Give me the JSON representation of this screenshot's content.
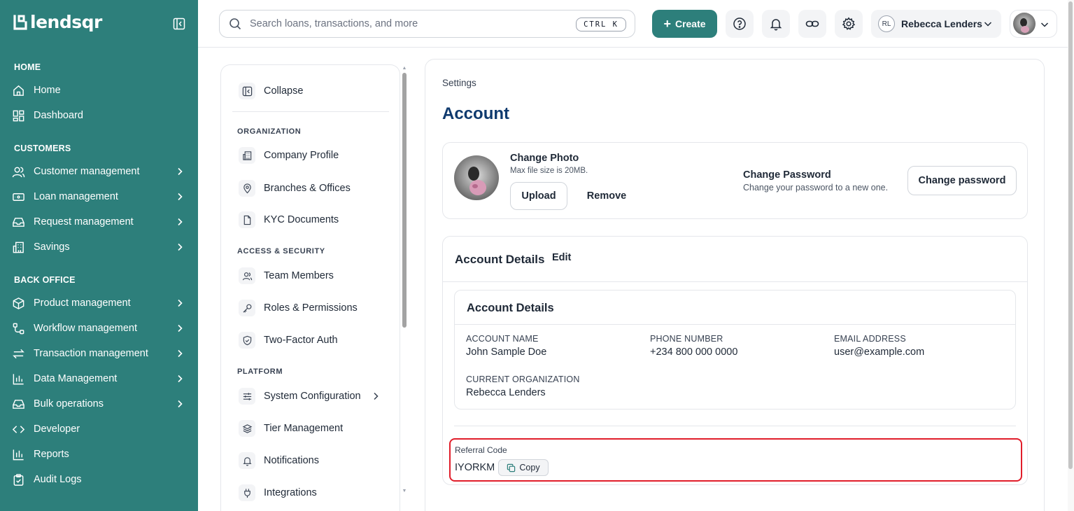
{
  "brand": {
    "name": "lendsqr",
    "color": "#2d7f7b"
  },
  "sidebar": {
    "sections": [
      {
        "title": "HOME"
      },
      {
        "title": "CUSTOMERS"
      },
      {
        "title": "BACK OFFICE"
      }
    ],
    "items": [
      {
        "label": "Home",
        "icon": "home-icon"
      },
      {
        "label": "Dashboard",
        "icon": "dashboard-icon"
      },
      {
        "label": "Customer management",
        "icon": "users-icon"
      },
      {
        "label": "Loan management",
        "icon": "money-icon"
      },
      {
        "label": "Request management",
        "icon": "inbox-icon"
      },
      {
        "label": "Savings",
        "icon": "building-icon"
      },
      {
        "label": "Product management",
        "icon": "box-icon"
      },
      {
        "label": "Workflow management",
        "icon": "workflow-icon"
      },
      {
        "label": "Transaction management",
        "icon": "transfer-icon"
      },
      {
        "label": "Data Management",
        "icon": "bar-chart-icon"
      },
      {
        "label": "Bulk operations",
        "icon": "tray-icon"
      },
      {
        "label": "Developer",
        "icon": "code-icon"
      },
      {
        "label": "Reports",
        "icon": "report-icon"
      },
      {
        "label": "Audit Logs",
        "icon": "clipboard-icon"
      }
    ]
  },
  "topbar": {
    "search_placeholder": "Search loans, transactions, and more",
    "shortcut": "CTRL K",
    "create_label": "Create",
    "org_initials": "RL",
    "org_name": "Rebecca Lenders"
  },
  "settings_nav": {
    "collapse_label": "Collapse",
    "sections": {
      "organization": "ORGANIZATION",
      "access_security": "ACCESS & SECURITY",
      "platform": "PLATFORM"
    },
    "items": [
      {
        "label": "Company Profile",
        "icon": "building-icon"
      },
      {
        "label": "Branches & Offices",
        "icon": "map-pin-icon"
      },
      {
        "label": "KYC Documents",
        "icon": "document-icon"
      },
      {
        "label": "Team Members",
        "icon": "users-icon"
      },
      {
        "label": "Roles & Permissions",
        "icon": "key-icon"
      },
      {
        "label": "Two-Factor Auth",
        "icon": "shield-icon"
      },
      {
        "label": "System Configuration",
        "icon": "sliders-icon"
      },
      {
        "label": "Tier Management",
        "icon": "layers-icon"
      },
      {
        "label": "Notifications",
        "icon": "bell-icon"
      },
      {
        "label": "Integrations",
        "icon": "plug-icon"
      }
    ]
  },
  "main": {
    "breadcrumb": "Settings",
    "title": "Account",
    "photo": {
      "title": "Change Photo",
      "subtitle": "Max file size is 20MB.",
      "upload_label": "Upload",
      "remove_label": "Remove"
    },
    "password": {
      "title": "Change Password",
      "subtitle": "Change your password to a new one.",
      "button_label": "Change password"
    },
    "details": {
      "title": "Account Details",
      "edit_label": "Edit",
      "inner_title": "Account Details",
      "fields": [
        {
          "label": "ACCOUNT NAME",
          "value": "John Sample Doe"
        },
        {
          "label": "PHONE NUMBER",
          "value": "+234 800 000 0000"
        },
        {
          "label": "EMAIL ADDRESS",
          "value": "user@example.com"
        },
        {
          "label": "CURRENT ORGANIZATION",
          "value": "Rebecca Lenders"
        }
      ]
    },
    "referral": {
      "label": "Referral Code",
      "code": "IYORKM",
      "copy_label": "Copy",
      "highlight_color": "#e11d2a"
    }
  }
}
